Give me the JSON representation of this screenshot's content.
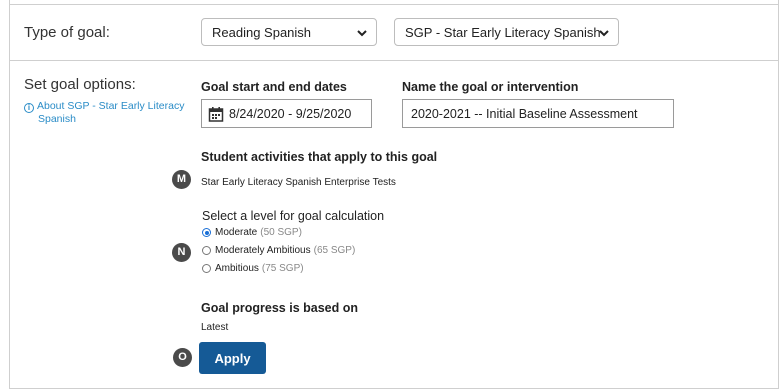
{
  "goal_type": {
    "label": "Type of goal:",
    "subject_select": "Reading Spanish",
    "assessment_select": "SGP - Star Early Literacy Spanish"
  },
  "options": {
    "label": "Set goal options:",
    "about_link_line1": "About SGP - Star Early Literacy",
    "about_link_line2": "Spanish",
    "dates_label": "Goal start and end dates",
    "dates_value": "8/24/2020 - 9/25/2020",
    "name_label": "Name the goal or intervention",
    "name_value": "2020-2021 --  Initial Baseline Assessment",
    "activities_label": "Student activities that apply to this goal",
    "activities_value": "Star Early Literacy Spanish Enterprise Tests",
    "level_label": "Select a level for goal calculation",
    "levels": [
      {
        "label": "Moderate",
        "note": "(50 SGP)",
        "selected": true
      },
      {
        "label": "Moderately Ambitious",
        "note": "(65 SGP)",
        "selected": false
      },
      {
        "label": "Ambitious",
        "note": "(75 SGP)",
        "selected": false
      }
    ],
    "progress_label": "Goal progress is based on",
    "progress_value": "Latest",
    "apply_label": "Apply"
  },
  "badges": {
    "m": "M",
    "n": "N",
    "o": "O"
  },
  "colors": {
    "apply_button": "#155a96",
    "link": "#2a8cc7",
    "radio_selected": "#1a6fd6",
    "badge": "#4a4a4a"
  },
  "icons": {
    "select_chevron": "chevron-down-icon",
    "date": "calendar-icon",
    "about": "info-icon"
  }
}
